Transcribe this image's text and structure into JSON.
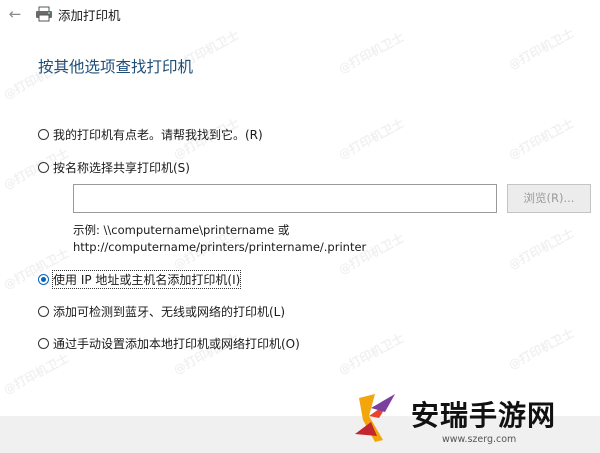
{
  "window": {
    "title": "添加打印机",
    "back_icon": "back-arrow-icon",
    "title_icon": "printer-icon"
  },
  "main": {
    "heading": "按其他选项查找打印机",
    "options": [
      {
        "label": "我的打印机有点老。请帮我找到它。(R)",
        "checked": false
      },
      {
        "label": "按名称选择共享打印机(S)",
        "checked": false
      },
      {
        "label": "使用 IP 地址或主机名添加打印机(I)",
        "checked": true
      },
      {
        "label": "添加可检测到蓝牙、无线或网络的打印机(L)",
        "checked": false
      },
      {
        "label": "通过手动设置添加本地打印机或网络打印机(O)",
        "checked": false
      }
    ],
    "share_input": {
      "value": "",
      "placeholder": ""
    },
    "browse_label": "浏览(R)...",
    "example_line1": "示例: \\\\computername\\printername 或",
    "example_line2": "http://computername/printers/printername/.printer"
  },
  "watermark": {
    "text": "@打印机卫士"
  },
  "logo": {
    "text": "安瑞手游网",
    "url": "www.szerg.com"
  },
  "colors": {
    "heading": "#1f4e79",
    "radio_selected": "#0067c0",
    "footer": "#f0f0f0"
  }
}
